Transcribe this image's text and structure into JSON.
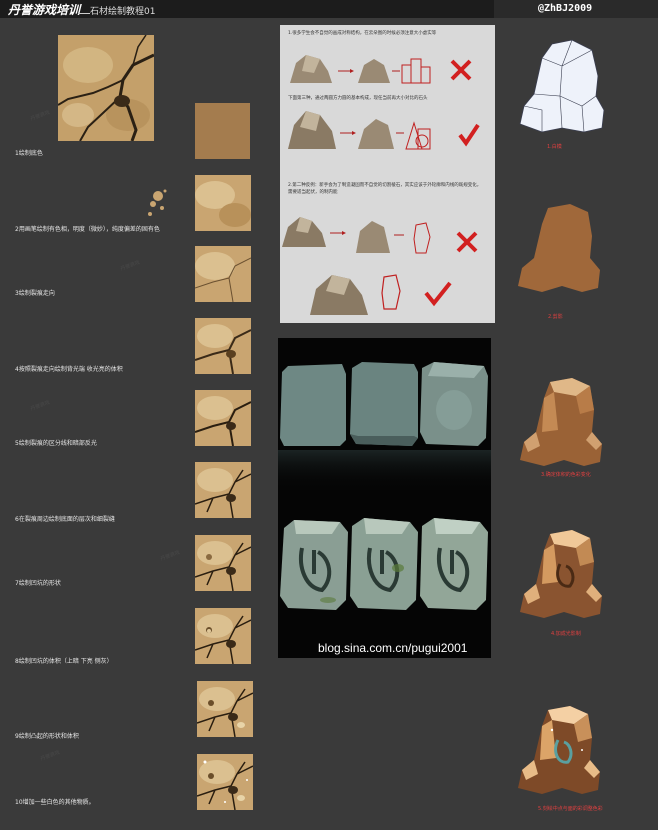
{
  "header": {
    "title": "丹誉游戏培训",
    "subtitle": "石材绘制教程01",
    "credit": "@ZhBJ2009"
  },
  "steps": [
    {
      "caption": "1绘制底色"
    },
    {
      "caption": "2用画笔绘制有色相，明度（微妙），纯度偏差的固有色"
    },
    {
      "caption": "3绘制裂痕走向"
    },
    {
      "caption": "4按照裂痕走向绘制背光端 收光亮的体积"
    },
    {
      "caption": "5绘制裂痕的区分线和暗部反光"
    },
    {
      "caption": "6在裂痕周边绘制底面的层次和细裂缝"
    },
    {
      "caption": "7绘制凹坑的形状"
    },
    {
      "caption": "8绘制凹坑的体积（上暗 下亮 侧灰）"
    },
    {
      "caption": "9绘制凸起的形状和体积"
    },
    {
      "caption": "10增加一些白色的其他物质。"
    }
  ],
  "guide_panel": {
    "note1": "1.很多学生会不自觉的画成对称结构，在云朵图的时候必须注意大小虚实等",
    "note2": "下面第三种，通过两圆方力圆的基本构成，现任当前再大小对比的石头",
    "note3_a": "2.第二种反例：新手会为了制造凝固而不自觉的切割棱石，其实应该于外轮廓和内线的既规变化，",
    "note3_b": "需要适当起伏，的制内能"
  },
  "render_panel": {
    "blog_url": "blog.sina.com.cn/pugui2001"
  },
  "rock_steps": [
    {
      "caption": "1.白模"
    },
    {
      "caption": "2.剪影"
    },
    {
      "caption": "3.确定体积的色彩变化"
    },
    {
      "caption": "4.加成光影制"
    },
    {
      "caption": "5.刻绘中点与面的彩调整色彩"
    }
  ],
  "colors": {
    "background": "#3a3a3a",
    "header": "#1c1c1c",
    "texture_base": "#c9a571",
    "rock_brown": "#a0683a",
    "red_mark": "#d22020"
  }
}
